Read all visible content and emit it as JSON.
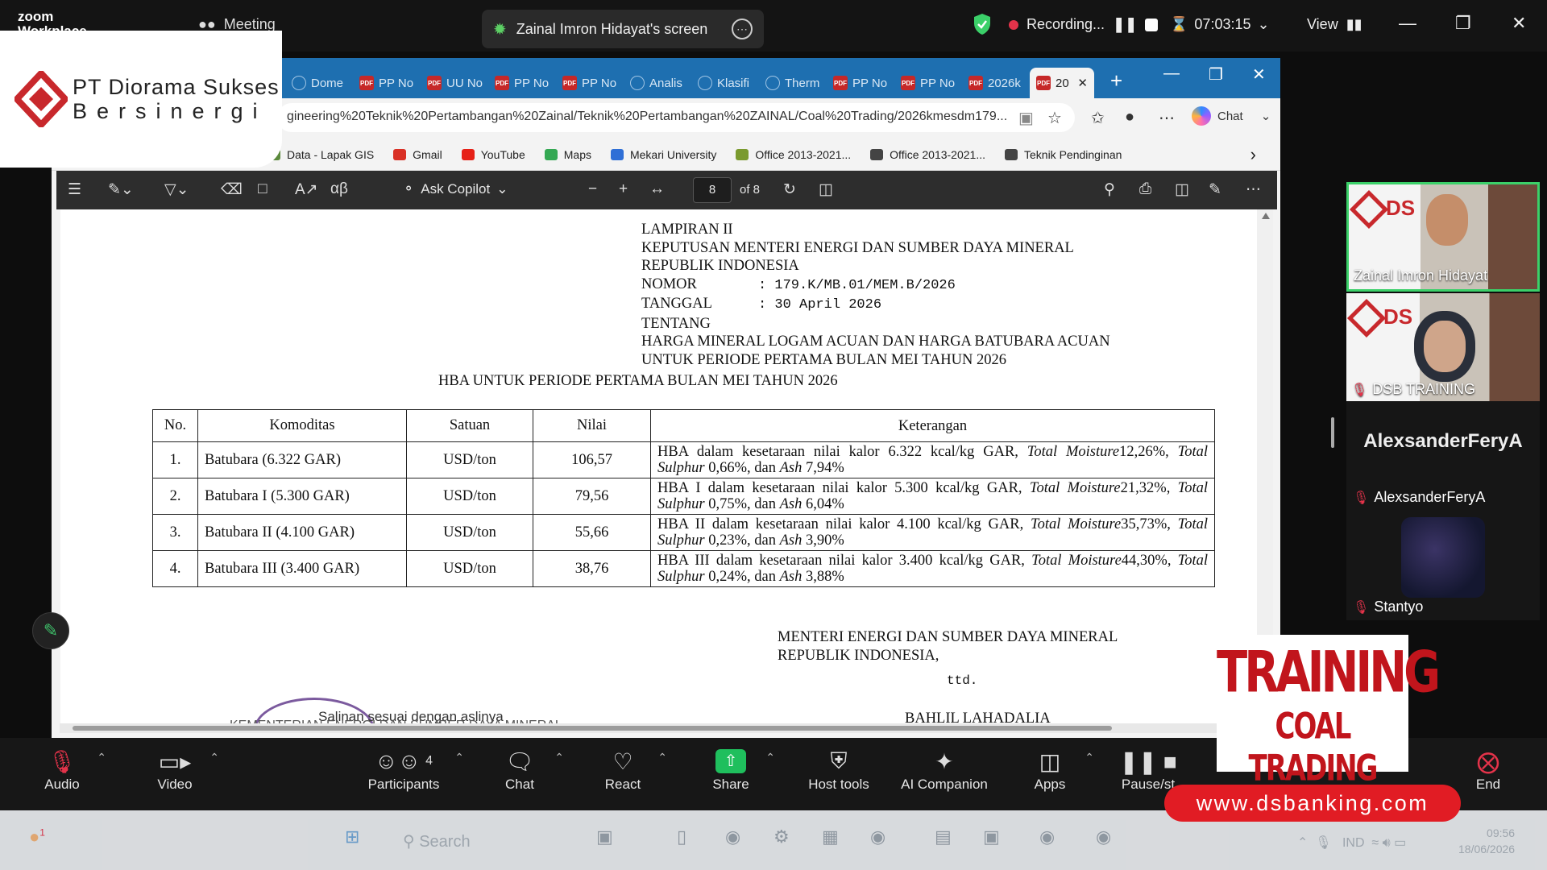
{
  "zoom": {
    "brand": "zoom",
    "brand_sub": "Workplace",
    "meeting_label": "Meeting",
    "share_source": "Zainal Imron Hidayat's screen",
    "recording_label": "Recording...",
    "elapsed": "07:03:15",
    "view_label": "View"
  },
  "company": {
    "line1": "PT Diorama  Sukses",
    "line2": "Bersinergi"
  },
  "browser": {
    "tabs": [
      {
        "label": "Dome",
        "icon": "globe"
      },
      {
        "label": "PP No",
        "icon": "pdf"
      },
      {
        "label": "UU No",
        "icon": "pdf"
      },
      {
        "label": "PP No",
        "icon": "pdf"
      },
      {
        "label": "PP No",
        "icon": "pdf"
      },
      {
        "label": "Analis",
        "icon": "globe"
      },
      {
        "label": "Klasifi",
        "icon": "globe"
      },
      {
        "label": "Therm",
        "icon": "globe"
      },
      {
        "label": "PP No",
        "icon": "pdf"
      },
      {
        "label": "PP No",
        "icon": "pdf"
      },
      {
        "label": "2026k",
        "icon": "pdf"
      }
    ],
    "active_tab": {
      "label": "20",
      "icon": "pdf"
    },
    "url": "gineering%20Teknik%20Pertambangan%20Zainal/Teknik%20Pertambangan%20ZAINAL/Coal%20Trading/2026kmesdm179...",
    "chat_label": "Chat",
    "favorites": [
      {
        "label": "Data - Lapak GIS",
        "color": "#5b8a3c"
      },
      {
        "label": "Gmail",
        "color": "#d93025"
      },
      {
        "label": "YouTube",
        "color": "#e62117"
      },
      {
        "label": "Maps",
        "color": "#34a853"
      },
      {
        "label": "Mekari University",
        "color": "#2f6fd6"
      },
      {
        "label": "Office 2013-2021...",
        "color": "#7a9a2e"
      },
      {
        "label": "Office 2013-2021...",
        "color": "#444444"
      },
      {
        "label": "Teknik Pendinginan",
        "color": "#444444"
      }
    ]
  },
  "pdf": {
    "ask_copilot": "Ask Copilot",
    "page_current": "8",
    "page_total": "of 8"
  },
  "document": {
    "lampiran": "LAMPIRAN II",
    "keputusan": "KEPUTUSAN MENTERI ENERGI DAN SUMBER DAYA MINERAL",
    "republik": "REPUBLIK INDONESIA",
    "nomor_label": "NOMOR",
    "nomor_value": ":  179.K/MB.01/MEM.B/2026",
    "tanggal_label": "TANGGAL",
    "tanggal_value": ":  30 April 2026",
    "tentang": "TENTANG",
    "subject1": "HARGA MINERAL LOGAM ACUAN DAN HARGA BATUBARA ACUAN",
    "subject2": "UNTUK PERIODE PERTAMA BULAN MEI TAHUN 2026",
    "table_title": "HBA UNTUK PERIODE PERTAMA BULAN MEI TAHUN 2026",
    "columns": [
      "No.",
      "Komoditas",
      "Satuan",
      "Nilai",
      "Keterangan"
    ],
    "rows": [
      {
        "no": "1.",
        "komoditas": "Batubara (6.322 GAR)",
        "satuan": "USD/ton",
        "nilai": "106,57",
        "ket_a": "HBA dalam kesetaraan nilai kalor 6.322 kcal/kg GAR, ",
        "ket_tm": "Total Moisture",
        "ket_b": "12,26%, ",
        "ket_ts": "Total Sulphur",
        "ket_c": " 0,66%, dan ",
        "ket_ash": "Ash",
        "ket_d": " 7,94%"
      },
      {
        "no": "2.",
        "komoditas": "Batubara I (5.300 GAR)",
        "satuan": "USD/ton",
        "nilai": "79,56",
        "ket_a": "HBA I dalam kesetaraan nilai kalor 5.300 kcal/kg GAR, ",
        "ket_tm": "Total Moisture",
        "ket_b": "21,32%, ",
        "ket_ts": "Total Sulphur",
        "ket_c": " 0,75%, dan ",
        "ket_ash": "Ash",
        "ket_d": " 6,04%"
      },
      {
        "no": "3.",
        "komoditas": "Batubara II (4.100 GAR)",
        "satuan": "USD/ton",
        "nilai": "55,66",
        "ket_a": "HBA II dalam kesetaraan nilai kalor 4.100 kcal/kg GAR, ",
        "ket_tm": "Total Moisture",
        "ket_b": "35,73%, ",
        "ket_ts": "Total Sulphur",
        "ket_c": " 0,23%, dan ",
        "ket_ash": "Ash",
        "ket_d": " 3,90%"
      },
      {
        "no": "4.",
        "komoditas": "Batubara III (3.400 GAR)",
        "satuan": "USD/ton",
        "nilai": "38,76",
        "ket_a": "HBA III dalam kesetaraan nilai kalor 3.400 kcal/kg GAR, ",
        "ket_tm": "Total Moisture",
        "ket_b": "44,30%, ",
        "ket_ts": "Total Sulphur",
        "ket_c": " 0,24%, dan ",
        "ket_ash": "Ash",
        "ket_d": " 3,88%"
      }
    ],
    "signer1": "MENTERI ENERGI DAN SUMBER DAYA MINERAL",
    "signer2": "REPUBLIK INDONESIA,",
    "ttd": "ttd.",
    "signer_name": "BAHLIL LAHADALIA",
    "salinan": "Salinan sesuai dengan aslinya",
    "cut_line": "KEMENTERIAN ENERGI DAN SUMBER DAYA MINERAL"
  },
  "participants": {
    "tiles": [
      {
        "name": "Zainal Imron Hidayat",
        "type": "video",
        "active": true,
        "muted": false
      },
      {
        "name": "DSB TRAINING",
        "type": "video",
        "active": false,
        "muted": true
      },
      {
        "name": "AlexsanderFeryA",
        "display": "AlexsanderFeryA",
        "type": "name",
        "muted": true
      },
      {
        "name": "Stantyo",
        "type": "avatar",
        "muted": true
      }
    ],
    "video_logo": "DS"
  },
  "badge": {
    "training": "TRAINING",
    "coal": "COAL TRADING",
    "website": "www.dsbanking.com"
  },
  "toolbar": {
    "audio": "Audio",
    "video": "Video",
    "participants": "Participants",
    "participants_count": "4",
    "chat": "Chat",
    "react": "React",
    "share": "Share",
    "host_tools": "Host tools",
    "ai_companion": "AI Companion",
    "apps": "Apps",
    "pause": "Pause/st",
    "end": "End"
  },
  "taskbar": {
    "search": "Search",
    "lang": "IND",
    "time": "09:56",
    "date": "18/06/2026",
    "notify_count": "1"
  },
  "colors": {
    "zoom_bg": "#141414",
    "recording_dot": "#e4334a",
    "active_speaker": "#3bd069",
    "brand_red": "#c1151c",
    "share_green": "#1fbf5d",
    "edge_tabbar": "#1e6fb0"
  }
}
